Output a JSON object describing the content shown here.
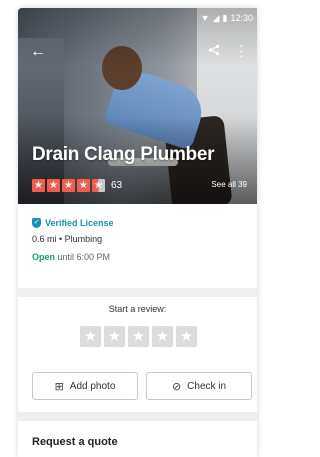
{
  "status_bar": {
    "time": "12:30",
    "wifi_icon": "wifi-icon",
    "signal_icon": "signal-icon",
    "battery_icon": "battery-icon"
  },
  "header": {
    "back_icon": "back-arrow-icon",
    "share_icon": "share-icon",
    "more_icon": "more-vert-icon"
  },
  "business": {
    "name": "Drain Clang Plumber",
    "rating": 4.5,
    "review_count": "63",
    "see_all": "See all 39"
  },
  "info": {
    "verified": "Verified License",
    "distance_category": "0.6 mi • Plumbing",
    "open_label": "Open",
    "hours_text": " until 6:00 PM"
  },
  "review": {
    "title": "Start a review:",
    "star_count": 5
  },
  "actions": {
    "add_photo": "Add photo",
    "check_in": "Check in"
  },
  "quote": {
    "title": "Request a quote"
  },
  "colors": {
    "star_red": "#f15c4f",
    "verified_blue": "#1a8fb8",
    "open_green": "#1a9f6a",
    "star_empty": "#dcdcdc"
  }
}
